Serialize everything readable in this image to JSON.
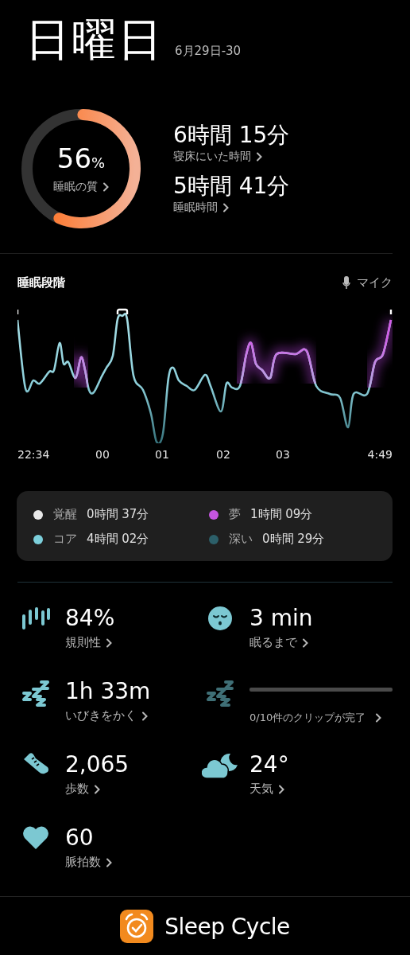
{
  "header": {
    "title": "日曜日",
    "date": "6月29日-30"
  },
  "quality": {
    "value": "56",
    "unit": "%",
    "label": "睡眠の質"
  },
  "durations": [
    {
      "value": "6時間 15分",
      "label": "寝床にいた時間"
    },
    {
      "value": "5時間 41分",
      "label": "睡眠時間"
    }
  ],
  "stages": {
    "title": "睡眠段階",
    "mic_label": "マイク",
    "time_labels": [
      "22:34",
      "00",
      "01",
      "02",
      "03",
      "4:49"
    ]
  },
  "legend": [
    {
      "name": "覚醒",
      "duration": "0時間 37分",
      "color": "#e8e8e8"
    },
    {
      "name": "夢",
      "duration": "1時間 09分",
      "color": "#c455e0"
    },
    {
      "name": "コア",
      "duration": "4時間 02分",
      "color": "#7ccfdb"
    },
    {
      "name": "深い",
      "duration": "0時間 29分",
      "color": "#2c5f69"
    }
  ],
  "stats": [
    {
      "kind": "regularity",
      "value": "84%",
      "label": "規則性"
    },
    {
      "kind": "fall_asleep",
      "value": "3 min",
      "label": "眠るまで"
    },
    {
      "kind": "snoring",
      "value": "1h 33m",
      "label": "いびきをかく"
    },
    {
      "kind": "clips",
      "level": 0,
      "label": "0/10件のクリップが完了"
    },
    {
      "kind": "steps",
      "value": "2,065",
      "label": "歩数"
    },
    {
      "kind": "weather",
      "value": "24°",
      "label": "天気"
    },
    {
      "kind": "heart_rate",
      "value": "60",
      "label": "脈拍数"
    }
  ],
  "footer": {
    "app_name": "Sleep Cycle"
  }
}
